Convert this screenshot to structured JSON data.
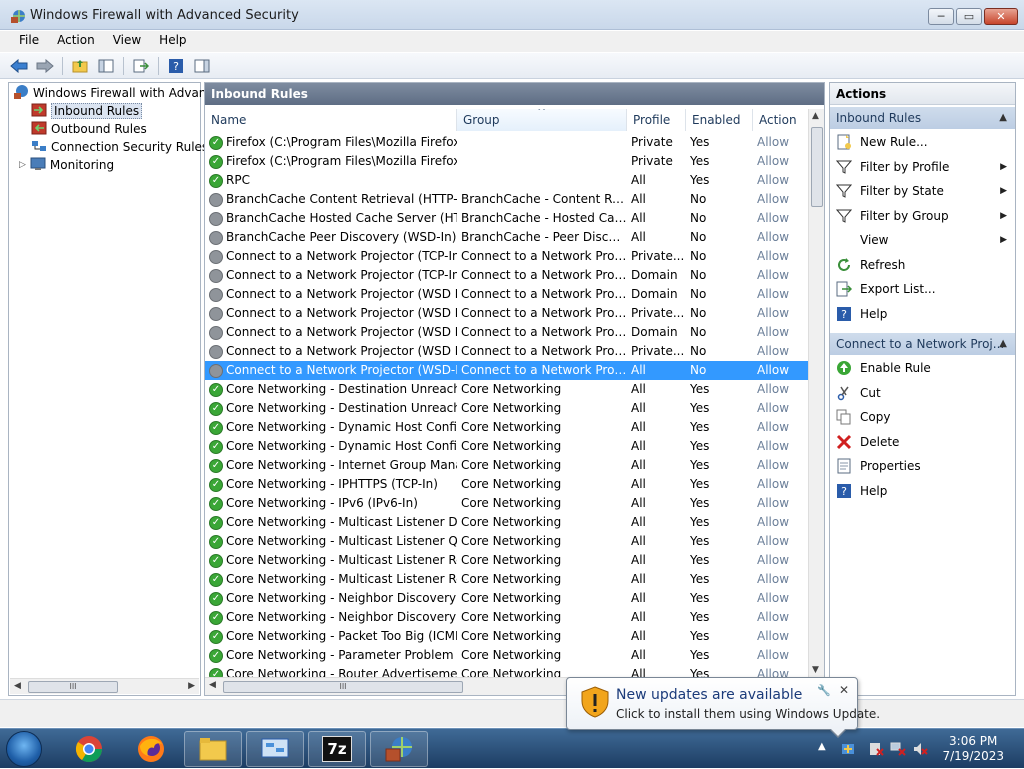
{
  "window": {
    "title": "Windows Firewall with Advanced Security",
    "minimize": "─",
    "maximize": "▭",
    "close": "✕"
  },
  "menu": [
    "File",
    "Action",
    "View",
    "Help"
  ],
  "tree": {
    "root": "Windows Firewall with Advance",
    "items": [
      "Inbound Rules",
      "Outbound Rules",
      "Connection Security Rules",
      "Monitoring"
    ],
    "scroll_thumb": "III"
  },
  "center": {
    "header": "Inbound Rules",
    "columns": [
      "Name",
      "Group",
      "Profile",
      "Enabled",
      "Action"
    ],
    "sort_indicator": "^",
    "scroll_thumb": "III",
    "rows": [
      {
        "name": "Firefox (C:\\Program Files\\Mozilla Firefox)",
        "group": "",
        "profile": "Private",
        "enabled": "Yes",
        "action": "Allow",
        "on": true
      },
      {
        "name": "Firefox (C:\\Program Files\\Mozilla Firefox)",
        "group": "",
        "profile": "Private",
        "enabled": "Yes",
        "action": "Allow",
        "on": true
      },
      {
        "name": "RPC",
        "group": "",
        "profile": "All",
        "enabled": "Yes",
        "action": "Allow",
        "on": true
      },
      {
        "name": "BranchCache Content Retrieval (HTTP-In)",
        "group": "BranchCache - Content Retr...",
        "profile": "All",
        "enabled": "No",
        "action": "Allow",
        "on": false
      },
      {
        "name": "BranchCache Hosted Cache Server (HTT...",
        "group": "BranchCache - Hosted Cach...",
        "profile": "All",
        "enabled": "No",
        "action": "Allow",
        "on": false
      },
      {
        "name": "BranchCache Peer Discovery (WSD-In)",
        "group": "BranchCache - Peer Discove...",
        "profile": "All",
        "enabled": "No",
        "action": "Allow",
        "on": false
      },
      {
        "name": "Connect to a Network Projector (TCP-In)",
        "group": "Connect to a Network Proje...",
        "profile": "Private...",
        "enabled": "No",
        "action": "Allow",
        "on": false
      },
      {
        "name": "Connect to a Network Projector (TCP-In)",
        "group": "Connect to a Network Proje...",
        "profile": "Domain",
        "enabled": "No",
        "action": "Allow",
        "on": false
      },
      {
        "name": "Connect to a Network Projector (WSD Ev...",
        "group": "Connect to a Network Proje...",
        "profile": "Domain",
        "enabled": "No",
        "action": "Allow",
        "on": false
      },
      {
        "name": "Connect to a Network Projector (WSD Ev...",
        "group": "Connect to a Network Proje...",
        "profile": "Private...",
        "enabled": "No",
        "action": "Allow",
        "on": false
      },
      {
        "name": "Connect to a Network Projector (WSD Ev...",
        "group": "Connect to a Network Proje...",
        "profile": "Domain",
        "enabled": "No",
        "action": "Allow",
        "on": false
      },
      {
        "name": "Connect to a Network Projector (WSD Ev...",
        "group": "Connect to a Network Proje...",
        "profile": "Private...",
        "enabled": "No",
        "action": "Allow",
        "on": false
      },
      {
        "name": "Connect to a Network Projector (WSD-In)",
        "group": "Connect to a Network Proje...",
        "profile": "All",
        "enabled": "No",
        "action": "Allow",
        "on": false,
        "selected": true
      },
      {
        "name": "Core Networking - Destination Unreacha...",
        "group": "Core Networking",
        "profile": "All",
        "enabled": "Yes",
        "action": "Allow",
        "on": true
      },
      {
        "name": "Core Networking - Destination Unreacha...",
        "group": "Core Networking",
        "profile": "All",
        "enabled": "Yes",
        "action": "Allow",
        "on": true
      },
      {
        "name": "Core Networking - Dynamic Host Config...",
        "group": "Core Networking",
        "profile": "All",
        "enabled": "Yes",
        "action": "Allow",
        "on": true
      },
      {
        "name": "Core Networking - Dynamic Host Config...",
        "group": "Core Networking",
        "profile": "All",
        "enabled": "Yes",
        "action": "Allow",
        "on": true
      },
      {
        "name": "Core Networking - Internet Group Mana...",
        "group": "Core Networking",
        "profile": "All",
        "enabled": "Yes",
        "action": "Allow",
        "on": true
      },
      {
        "name": "Core Networking - IPHTTPS (TCP-In)",
        "group": "Core Networking",
        "profile": "All",
        "enabled": "Yes",
        "action": "Allow",
        "on": true
      },
      {
        "name": "Core Networking - IPv6 (IPv6-In)",
        "group": "Core Networking",
        "profile": "All",
        "enabled": "Yes",
        "action": "Allow",
        "on": true
      },
      {
        "name": "Core Networking - Multicast Listener Do...",
        "group": "Core Networking",
        "profile": "All",
        "enabled": "Yes",
        "action": "Allow",
        "on": true
      },
      {
        "name": "Core Networking - Multicast Listener Qu...",
        "group": "Core Networking",
        "profile": "All",
        "enabled": "Yes",
        "action": "Allow",
        "on": true
      },
      {
        "name": "Core Networking - Multicast Listener Rep...",
        "group": "Core Networking",
        "profile": "All",
        "enabled": "Yes",
        "action": "Allow",
        "on": true
      },
      {
        "name": "Core Networking - Multicast Listener Rep...",
        "group": "Core Networking",
        "profile": "All",
        "enabled": "Yes",
        "action": "Allow",
        "on": true
      },
      {
        "name": "Core Networking - Neighbor Discovery A...",
        "group": "Core Networking",
        "profile": "All",
        "enabled": "Yes",
        "action": "Allow",
        "on": true
      },
      {
        "name": "Core Networking - Neighbor Discovery S...",
        "group": "Core Networking",
        "profile": "All",
        "enabled": "Yes",
        "action": "Allow",
        "on": true
      },
      {
        "name": "Core Networking - Packet Too Big (ICMP...",
        "group": "Core Networking",
        "profile": "All",
        "enabled": "Yes",
        "action": "Allow",
        "on": true
      },
      {
        "name": "Core Networking - Parameter Problem (I...",
        "group": "Core Networking",
        "profile": "All",
        "enabled": "Yes",
        "action": "Allow",
        "on": true
      },
      {
        "name": "Core Networking - Router Advertisement...",
        "group": "Core Networking",
        "profile": "All",
        "enabled": "Yes",
        "action": "Allow",
        "on": true
      }
    ]
  },
  "actions": {
    "title": "Actions",
    "section1": "Inbound Rules",
    "section1_items": [
      {
        "label": "New Rule...",
        "icon": "new-rule-icon",
        "submenu": false
      },
      {
        "label": "Filter by Profile",
        "icon": "filter-icon",
        "submenu": true
      },
      {
        "label": "Filter by State",
        "icon": "filter-icon",
        "submenu": true
      },
      {
        "label": "Filter by Group",
        "icon": "filter-icon",
        "submenu": true
      },
      {
        "label": "View",
        "icon": "",
        "submenu": true
      },
      {
        "label": "Refresh",
        "icon": "refresh-icon",
        "submenu": false
      },
      {
        "label": "Export List...",
        "icon": "export-icon",
        "submenu": false
      },
      {
        "label": "Help",
        "icon": "help-icon",
        "submenu": false
      }
    ],
    "section2": "Connect to a Network Proj...",
    "section2_items": [
      {
        "label": "Enable Rule",
        "icon": "enable-icon"
      },
      {
        "label": "Cut",
        "icon": "cut-icon"
      },
      {
        "label": "Copy",
        "icon": "copy-icon"
      },
      {
        "label": "Delete",
        "icon": "delete-icon"
      },
      {
        "label": "Properties",
        "icon": "properties-icon"
      },
      {
        "label": "Help",
        "icon": "help-icon"
      }
    ]
  },
  "balloon": {
    "title": "New updates are available",
    "text": "Click to install them using Windows Update.",
    "close": "✕"
  },
  "taskbar": {
    "time": "3:06 PM",
    "date": "7/19/2023",
    "seven_zip": "7z"
  },
  "colors": {
    "selection": "#3399ff",
    "header_gray": "#5e6d84",
    "enabled_green": "#3aa636",
    "disabled_gray": "#8f949a"
  }
}
